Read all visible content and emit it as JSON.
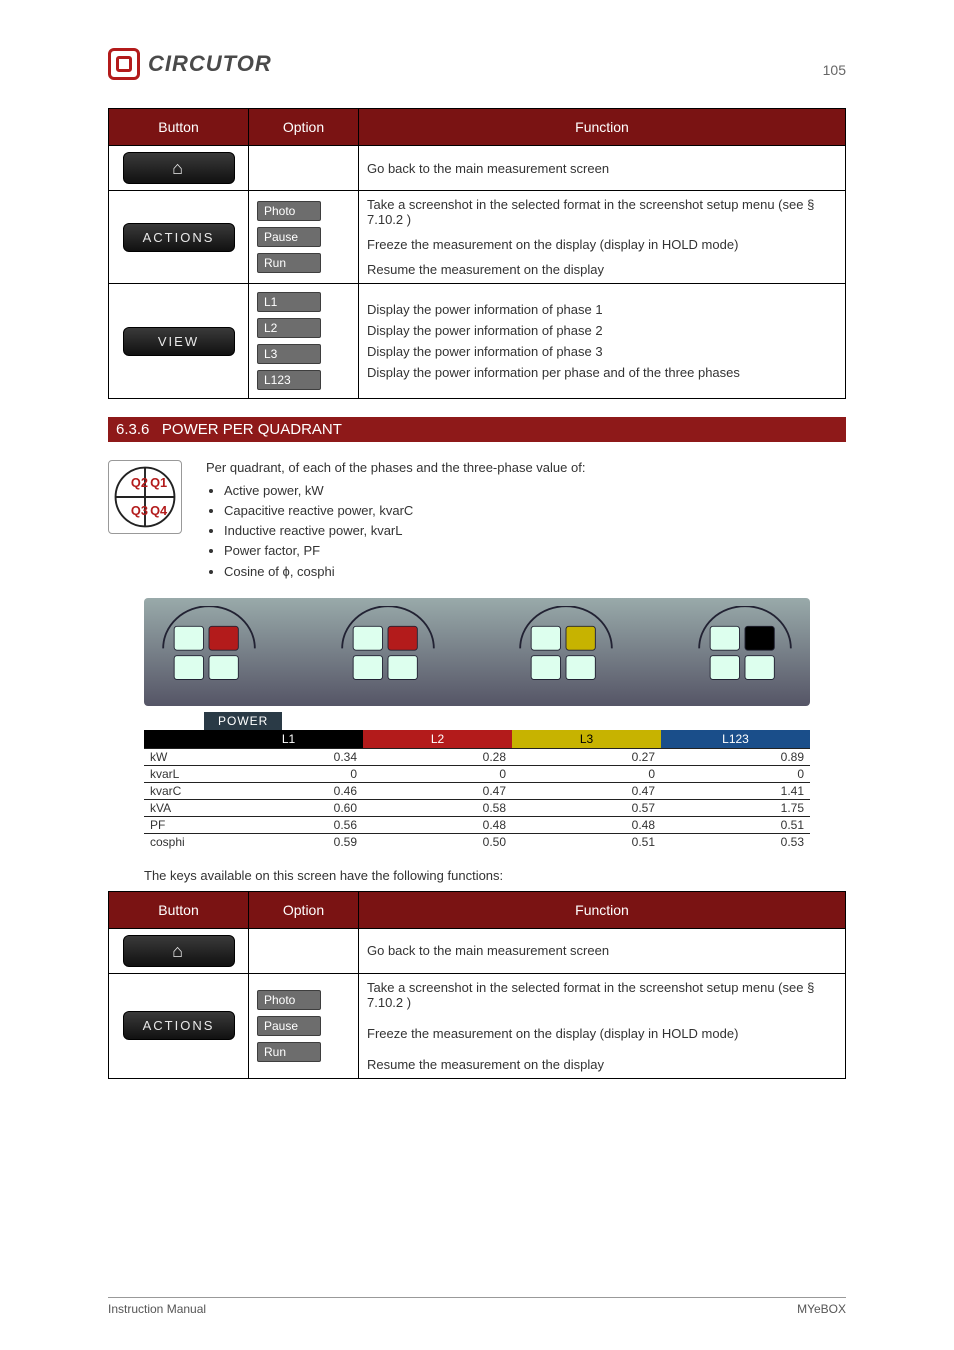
{
  "brand": "CIRCUTOR",
  "page_top": "105",
  "opt_table_headers": [
    "Button",
    "Option",
    "Function"
  ],
  "table1": {
    "rows": [
      {
        "btn": "home",
        "opt": "",
        "fn": "Go back to the main measurement screen"
      },
      {
        "btn": "ACTIONS",
        "opts": [
          "Photo",
          "Pause",
          "Run"
        ],
        "fns": [
          "Take a screenshot in the selected format in the screenshot setup menu (see § 7.10.2 )",
          "Freeze the measurement on the display (display in HOLD mode)",
          "Resume the measurement on the display"
        ]
      },
      {
        "btn": "VIEW",
        "opts": [
          "L1",
          "L2",
          "L3",
          "L123"
        ],
        "fns": [
          "Display the power information of phase 1",
          "Display the power information of phase 2",
          "Display the power information of phase 3",
          "Display the power information per phase and of the three phases"
        ]
      }
    ]
  },
  "section": {
    "num": "6.3.6",
    "title": "POWER PER QUADRANT"
  },
  "measurements": [
    "Active power, kW",
    "Capacitive reactive power, kvarC",
    "Inductive reactive power, kvarL",
    "Power factor, PF",
    "Cosine of ϕ, cosphi"
  ],
  "intro_line": "Per quadrant, of each of the phases and the three-phase value of:",
  "chart_data": {
    "type": "table",
    "title": "POWER",
    "columns": [
      "",
      "L1",
      "L2",
      "L3",
      "L123"
    ],
    "header_colors": [
      "#000000",
      "#000000",
      "#b31b1b",
      "#c7b300",
      "#1a4e8a"
    ],
    "rows": [
      {
        "label": "kW",
        "L1": 0.34,
        "L2": 0.28,
        "L3": 0.27,
        "L123": 0.89
      },
      {
        "label": "kvarL",
        "L1": 0,
        "L2": 0,
        "L3": 0,
        "L123": 0
      },
      {
        "label": "kvarC",
        "L1": 0.46,
        "L2": 0.47,
        "L3": 0.47,
        "L123": 1.41
      },
      {
        "label": "kVA",
        "L1": 0.6,
        "L2": 0.58,
        "L3": 0.57,
        "L123": 1.75
      },
      {
        "label": "PF",
        "L1": 0.56,
        "L2": 0.48,
        "L3": 0.48,
        "L123": 0.51
      },
      {
        "label": "cosphi",
        "L1": 0.59,
        "L2": 0.5,
        "L3": 0.51,
        "L123": 0.53
      }
    ]
  },
  "quadrant_highlight_fill": [
    "#b31b1b",
    "#b31b1b",
    "#c7b300",
    "#000000"
  ],
  "paragraph2": "The keys available on this screen have the following functions:",
  "table2": {
    "rows": [
      {
        "btn": "home",
        "opt": "",
        "fn": "Go back to the main measurement screen"
      },
      {
        "btn": "ACTIONS",
        "opts": [
          "Photo",
          "Pause",
          "Run"
        ],
        "fns": [
          "Take a screenshot in the selected format in the screenshot setup menu (see § 7.10.2 )",
          "Freeze the measurement on the display (display in HOLD mode)",
          "Resume the measurement on the display"
        ]
      }
    ]
  },
  "footer": {
    "left": "Instruction Manual",
    "right": "MYeBOX"
  }
}
